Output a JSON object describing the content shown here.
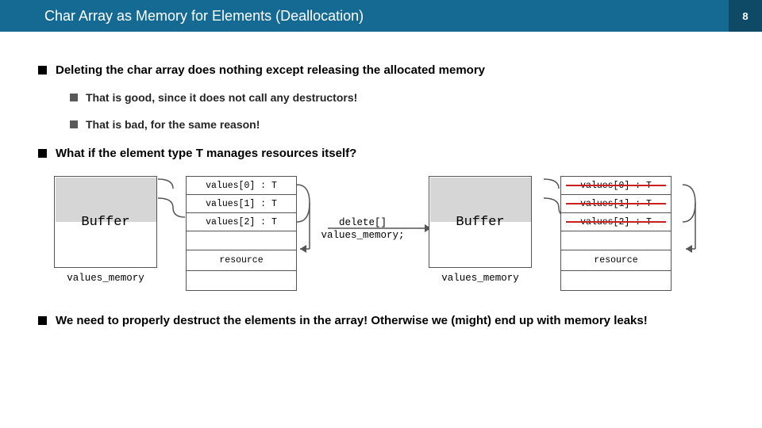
{
  "header": {
    "title": "Char Array as Memory for Elements (Deallocation)",
    "page": "8"
  },
  "bullets": {
    "b1": "Deleting the char array does nothing except releasing the allocated memory",
    "b1a": "That is good, since it does not call any destructors!",
    "b1b": "That is bad, for the same reason!",
    "b2": "What if the element type T manages resources itself?",
    "b3": "We need to properly destruct the elements in the array! Otherwise we (might) end up with memory leaks!"
  },
  "diagram": {
    "buffer": "Buffer",
    "values_memory": "values_memory",
    "cells": {
      "v0": "values[0] : T",
      "v1": "values[1] : T",
      "v2": "values[2] : T",
      "resource": "resource"
    },
    "op": {
      "l1": "delete[]",
      "l2": "values_memory;"
    }
  }
}
